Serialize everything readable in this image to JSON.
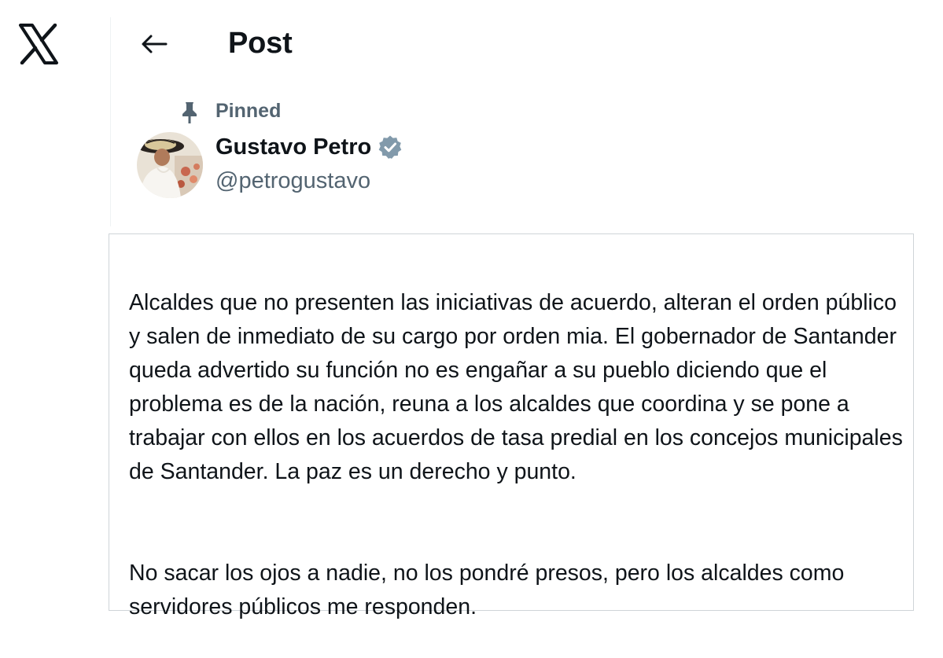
{
  "header": {
    "title": "Post"
  },
  "icons": {
    "logo": "x-logo-icon",
    "back": "arrow-left-icon",
    "pin": "pin-icon",
    "verified": "verified-badge-icon"
  },
  "colors": {
    "text_primary": "#0f1419",
    "text_secondary": "#536471",
    "verified_badge": "#829aab",
    "border": "#cfd4d8"
  },
  "post": {
    "pinned_label": "Pinned",
    "author": {
      "name": "Gustavo Petro",
      "handle": "@petrogustavo",
      "verified": true
    },
    "paragraphs": [
      "Alcaldes que no presenten las iniciativas de acuerdo, alteran el orden público y salen de inmediato de su cargo por orden mia. El gobernador de Santander queda advertido su función no es engañar a su pueblo diciendo que el problema es de la nación, reuna a los alcaldes que coordina y se pone a trabajar con ellos en los acuerdos de tasa predial en los concejos municipales de Santander. La paz es un derecho y punto.",
      "No sacar los ojos a nadie, no los pondré presos, pero los alcaldes como servidores públicos me responden."
    ]
  }
}
